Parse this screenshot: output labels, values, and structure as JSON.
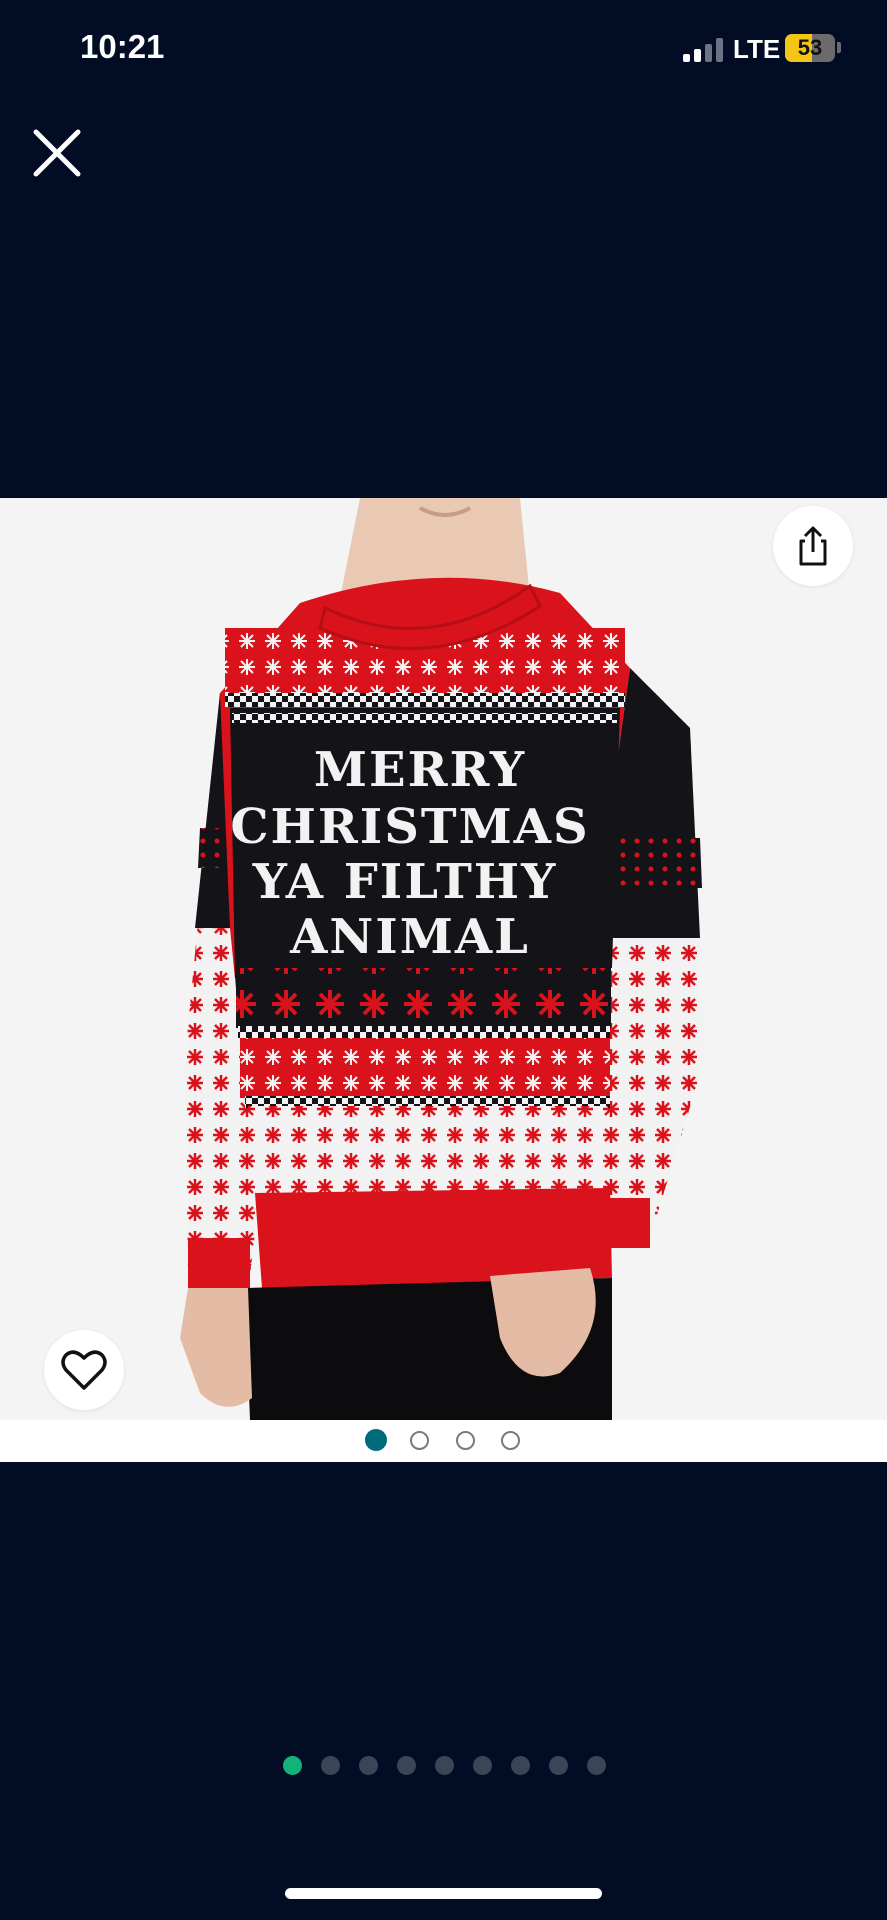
{
  "status_bar": {
    "time": "10:21",
    "network": "LTE",
    "battery_percent": "53",
    "battery_level": 0.53,
    "battery_color": "#f3c515",
    "signal_bars_active": 2,
    "signal_bars_total": 4
  },
  "icons": {
    "close": "close-icon",
    "share": "share-icon",
    "favorite": "heart-icon"
  },
  "product_image": {
    "sweater_text": [
      "MERRY",
      "CHRISTMAS",
      "YA FILTHY",
      "ANIMAL"
    ],
    "colors": {
      "background": "#f4f4f4",
      "sweater_red": "#d9121b",
      "sweater_black": "#141418",
      "sweater_white": "#f2f2f2"
    }
  },
  "image_carousel": {
    "count": 4,
    "active_index": 0,
    "active_color": "#006b7a"
  },
  "page_indicator": {
    "count": 9,
    "active_index": 0,
    "active_color": "#12b27a"
  }
}
